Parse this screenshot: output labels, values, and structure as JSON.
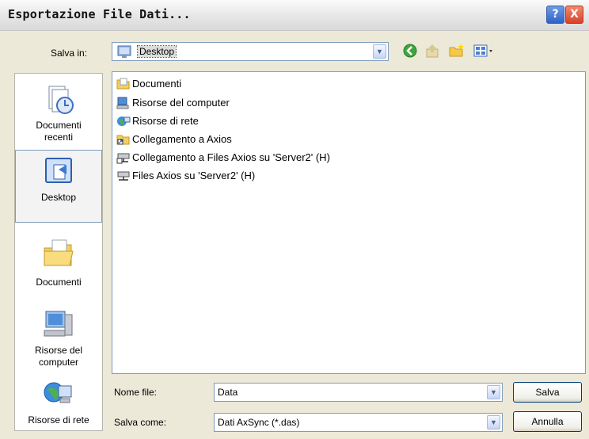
{
  "window": {
    "title": "Esportazione File Dati...",
    "help_label": "?",
    "close_label": "X"
  },
  "toolbar": {
    "save_in_label": "Salva in:",
    "location_value": "Desktop",
    "icons": [
      "back-icon",
      "up-folder-icon",
      "new-folder-icon",
      "view-menu-icon"
    ]
  },
  "places": [
    {
      "label": "Documenti recenti",
      "icon": "recent-documents-icon"
    },
    {
      "label": "Desktop",
      "icon": "desktop-icon"
    },
    {
      "label": "Documenti",
      "icon": "documents-folder-icon"
    },
    {
      "label": "Risorse del computer",
      "icon": "my-computer-icon"
    },
    {
      "label": "Risorse di rete",
      "icon": "network-icon"
    }
  ],
  "files": [
    {
      "name": "Documenti",
      "icon": "folder-icon"
    },
    {
      "name": "Risorse del computer",
      "icon": "computer-icon"
    },
    {
      "name": "Risorse di rete",
      "icon": "network-icon"
    },
    {
      "name": "Collegamento a Axios",
      "icon": "shortcut-icon"
    },
    {
      "name": "Collegamento a Files Axios su 'Server2' (H)",
      "icon": "network-drive-icon"
    },
    {
      "name": "Files Axios su 'Server2' (H)",
      "icon": "network-drive-icon"
    }
  ],
  "bottom": {
    "filename_label": "Nome file:",
    "filename_value": "Data",
    "savetype_label": "Salva come:",
    "savetype_value": "Dati AxSync (*.das)",
    "save_button": "Salva",
    "cancel_button": "Annulla"
  }
}
